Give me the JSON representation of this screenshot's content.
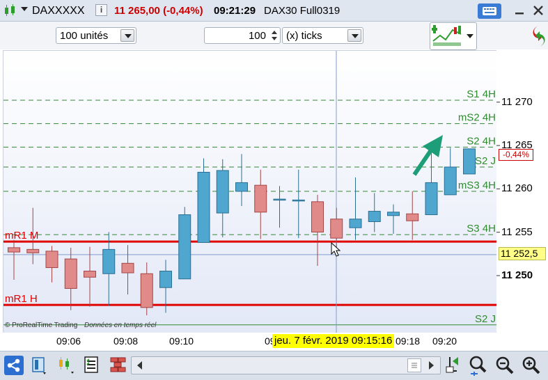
{
  "window": {
    "symbol": "DAXXXXX",
    "info_glyph": "i",
    "price_change": "11 265,00 (-0,44%)",
    "time": "09:21:29",
    "instrument": "DAX30 Full0319",
    "colors": {
      "negative": "#cc0000",
      "titlebar": "#dfe6f0"
    }
  },
  "toolbar": {
    "quantity": "100 unités",
    "ticks_value": "100",
    "ticks_unit": "(x) ticks"
  },
  "chart": {
    "levels": [
      {
        "label": "S1 4H",
        "price": 11270.3,
        "style": "dashed"
      },
      {
        "label": "mS2 4H",
        "price": 11267.6,
        "style": "dashed"
      },
      {
        "label": "S2 4H",
        "price": 11264.9,
        "style": "dashed"
      },
      {
        "label": "mS2 J",
        "price": 11262.6,
        "style": "dashed"
      },
      {
        "label": "mS3 4H",
        "price": 11259.8,
        "style": "dashed"
      },
      {
        "label": "S3 4H",
        "price": 11254.8,
        "style": "dashed"
      },
      {
        "label": "mR1 M",
        "price": 11254.0,
        "style": "solid-red"
      },
      {
        "label": "mR1 H",
        "price": 11246.7,
        "style": "solid-red"
      },
      {
        "label": "S2 J",
        "price": 11244.4,
        "style": "solid-green"
      }
    ],
    "last_price_line": 11252.5,
    "change_badge": "-0,44%",
    "price_badge": "11 252,5",
    "price_ticks": [
      "11 270",
      "11 265",
      "11 260",
      "11 255",
      "11 250"
    ],
    "time_ticks": [
      "09:06",
      "09:08",
      "09:10",
      "09:18",
      "09:20"
    ],
    "cursor_tooltip": "jeu. 7 févr. 2019 09:15:16",
    "cursor_time_fragment": "09",
    "copyright": "© ProRealTime Trading",
    "realtime_note": "Données en temps réel"
  },
  "chart_data": {
    "type": "candlestick",
    "y_range": [
      11243.5,
      11276.0
    ],
    "candles": [
      {
        "o": 11253.3,
        "h": 11254.2,
        "l": 11249.6,
        "c": 11252.8
      },
      {
        "o": 11253.1,
        "h": 11257.9,
        "l": 11251.4,
        "c": 11252.7
      },
      {
        "o": 11252.9,
        "h": 11253.5,
        "l": 11249.3,
        "c": 11251.0
      },
      {
        "o": 11252.0,
        "h": 11253.3,
        "l": 11246.1,
        "c": 11248.6
      },
      {
        "o": 11250.6,
        "h": 11253.4,
        "l": 11246.5,
        "c": 11249.9
      },
      {
        "o": 11250.3,
        "h": 11255.1,
        "l": 11246.6,
        "c": 11253.1
      },
      {
        "o": 11251.5,
        "h": 11253.6,
        "l": 11247.9,
        "c": 11250.4
      },
      {
        "o": 11250.3,
        "h": 11251.6,
        "l": 11245.5,
        "c": 11246.4
      },
      {
        "o": 11248.7,
        "h": 11251.9,
        "l": 11245.8,
        "c": 11250.6
      },
      {
        "o": 11249.7,
        "h": 11258.0,
        "l": 11249.7,
        "c": 11257.1
      },
      {
        "o": 11253.9,
        "h": 11263.6,
        "l": 11253.9,
        "c": 11262.0
      },
      {
        "o": 11257.3,
        "h": 11263.5,
        "l": 11254.5,
        "c": 11262.2
      },
      {
        "o": 11259.8,
        "h": 11264.1,
        "l": 11258.1,
        "c": 11260.8
      },
      {
        "o": 11260.5,
        "h": 11262.3,
        "l": 11254.3,
        "c": 11257.4
      },
      {
        "o": 11258.9,
        "h": 11260.4,
        "l": 11255.6,
        "c": 11258.9
      },
      {
        "o": 11258.8,
        "h": 11262.3,
        "l": 11254.4,
        "c": 11258.8
      },
      {
        "o": 11258.6,
        "h": 11259.4,
        "l": 11251.2,
        "c": 11255.1
      },
      {
        "o": 11256.6,
        "h": 11257.9,
        "l": 11253.1,
        "c": 11254.4
      },
      {
        "o": 11255.6,
        "h": 11261.4,
        "l": 11254.2,
        "c": 11256.6
      },
      {
        "o": 11256.3,
        "h": 11259.6,
        "l": 11255.1,
        "c": 11257.5
      },
      {
        "o": 11257.0,
        "h": 11258.3,
        "l": 11254.9,
        "c": 11257.4
      },
      {
        "o": 11257.2,
        "h": 11259.8,
        "l": 11254.2,
        "c": 11256.4
      },
      {
        "o": 11257.1,
        "h": 11264.2,
        "l": 11257.1,
        "c": 11260.8
      },
      {
        "o": 11259.4,
        "h": 11264.8,
        "l": 11259.4,
        "c": 11262.6
      },
      {
        "o": 11261.8,
        "h": 11264.2,
        "l": 11261.8,
        "c": 11264.7
      }
    ],
    "colors": {
      "up": "#4fa6cf",
      "down": "#e08a8a"
    }
  }
}
